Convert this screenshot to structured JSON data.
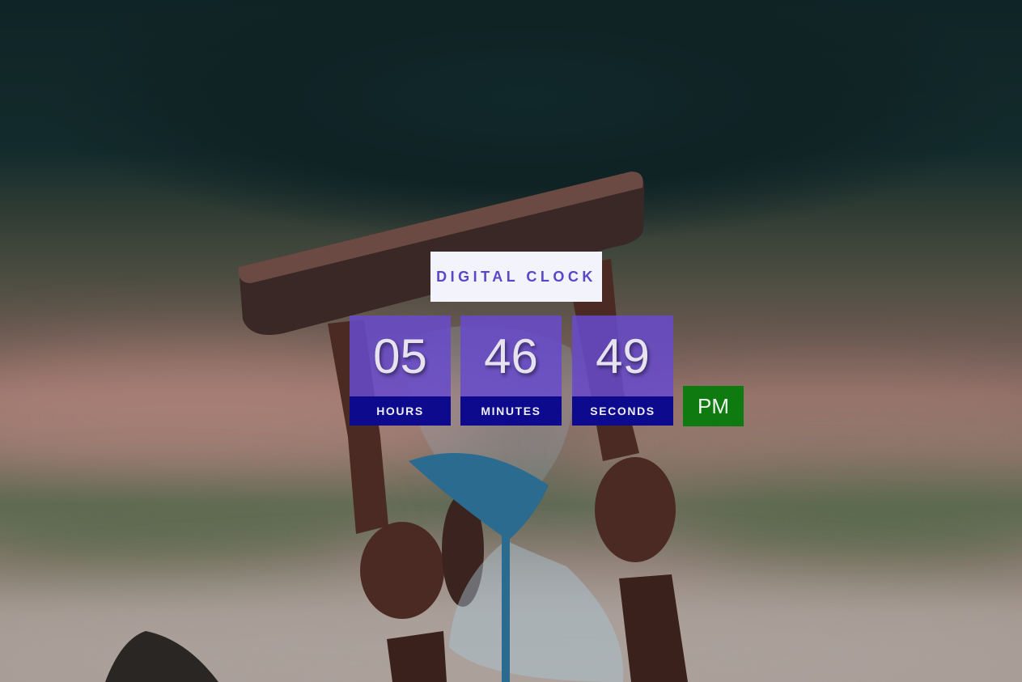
{
  "clock": {
    "title": "DIGITAL CLOCK",
    "hours": "05",
    "minutes": "46",
    "seconds": "49",
    "hours_label": "HOURS",
    "minutes_label": "MINUTES",
    "seconds_label": "SECONDS",
    "period": "PM"
  },
  "colors": {
    "title_bg": "#f2f3fb",
    "title_text": "#5b45c9",
    "digit_bg": "#684acc",
    "label_bg": "#0d0a8e",
    "period_bg": "#0e7a0f"
  }
}
